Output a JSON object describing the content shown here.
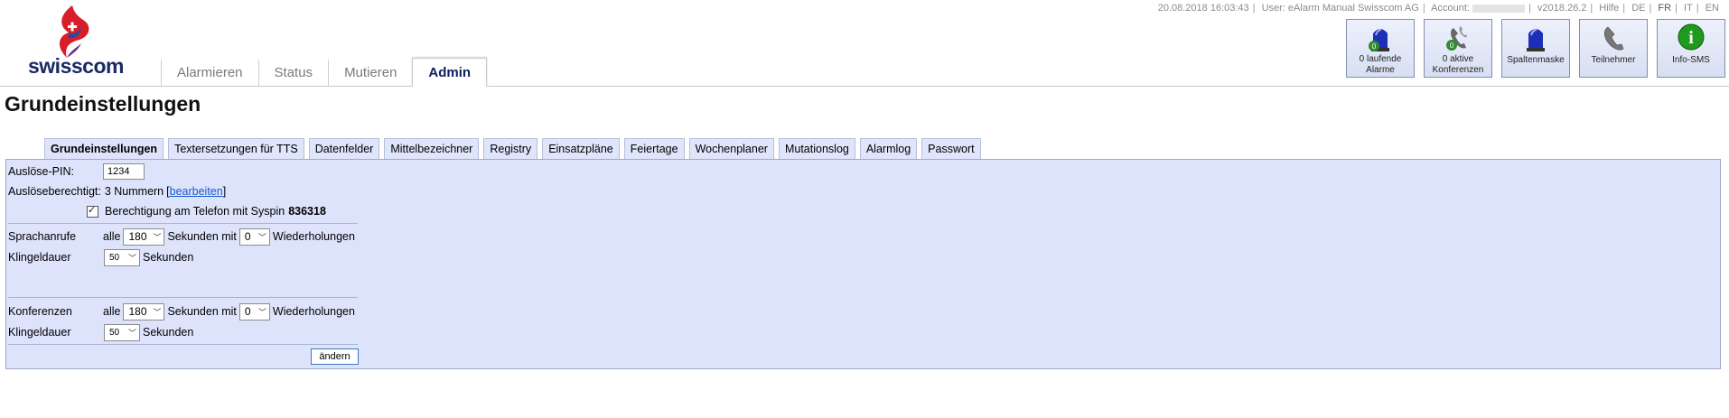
{
  "brand": {
    "logo_text": "swisscom"
  },
  "main_nav": {
    "tabs": [
      {
        "label": "Alarmieren"
      },
      {
        "label": "Status"
      },
      {
        "label": "Mutieren"
      },
      {
        "label": "Admin"
      }
    ],
    "active": "Admin"
  },
  "topline": {
    "datetime": "20.08.2018 16:03:43",
    "user": "User: eAlarm Manual Swisscom AG",
    "account_label": "Account:",
    "version": "v2018.26.2",
    "help": "Hilfe",
    "languages": [
      "DE",
      "FR",
      "IT",
      "EN"
    ],
    "active_language": "FR"
  },
  "quick_tiles": [
    {
      "label_1": "0 laufende",
      "label_2": "Alarme",
      "icon": "siren-icon",
      "badge": "0"
    },
    {
      "label_1": "0 aktive",
      "label_2": "Konferenzen",
      "icon": "conference-phone-icon",
      "badge": "0"
    },
    {
      "label_1": "Spaltenmaske",
      "icon": "siren-icon"
    },
    {
      "label_1": "Teilnehmer",
      "icon": "phone-icon"
    },
    {
      "label_1": "Info-SMS",
      "icon": "info-icon",
      "badge": "i"
    }
  ],
  "page": {
    "title": "Grundeinstellungen"
  },
  "subtabs": [
    "Grundeinstellungen",
    "Textersetzungen für TTS",
    "Datenfelder",
    "Mittelbezeichner",
    "Registry",
    "Einsatzpläne",
    "Feiertage",
    "Wochenplaner",
    "Mutationslog",
    "Alarmlog",
    "Passwort"
  ],
  "form": {
    "trigger_pin_label": "Auslöse-PIN:",
    "trigger_pin_value": "1234",
    "authorized_label": "Auslöseberechtigt:",
    "authorized_value": "3 Nummern",
    "edit_link": "bearbeiten",
    "phone_permission_text": "Berechtigung am Telefon mit Syspin",
    "syspin": "836318",
    "phone_permission_checked": true,
    "voice_calls": {
      "label": "Sprachanrufe",
      "every": "alle",
      "interval": "180",
      "seconds_with": "Sekunden mit",
      "repeats": "0",
      "repeats_label": "Wiederholungen"
    },
    "ring_duration_1": {
      "label": "Klingeldauer",
      "value": "50",
      "unit": "Sekunden"
    },
    "conferences": {
      "label": "Konferenzen",
      "every": "alle",
      "interval": "180",
      "seconds_with": "Sekunden mit",
      "repeats": "0",
      "repeats_label": "Wiederholungen"
    },
    "ring_duration_2": {
      "label": "Klingeldauer",
      "value": "50",
      "unit": "Sekunden"
    },
    "submit_label": "ändern"
  },
  "colors": {
    "panel_bg": "#dde3fb",
    "brand_navy": "#1a2b63",
    "link": "#1a5bd0"
  }
}
